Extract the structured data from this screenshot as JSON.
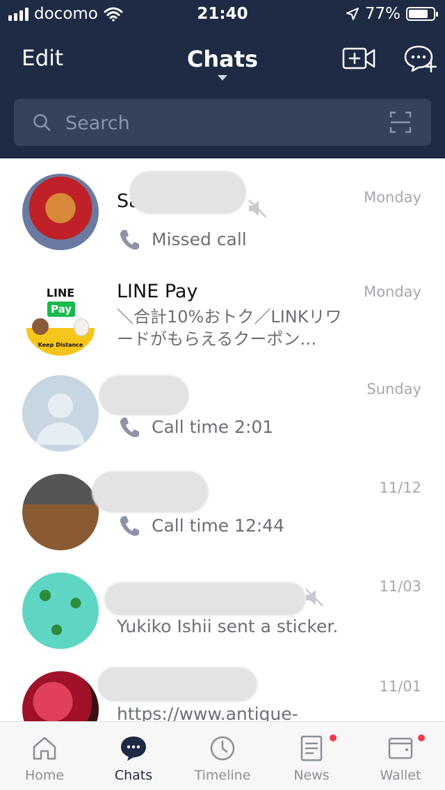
{
  "status": {
    "carrier": "docomo",
    "time": "21:40",
    "battery": "77%"
  },
  "header": {
    "edit_label": "Edit",
    "title": "Chats"
  },
  "search": {
    "placeholder": "Search"
  },
  "chats": [
    {
      "name": "Sa",
      "date": "Monday",
      "message": "Missed call",
      "muted": true,
      "call": true
    },
    {
      "name": "LINE Pay",
      "date": "Monday",
      "message": "＼合計10%おトク／LINKリワードがもらえるクーポン…",
      "muted": false,
      "call": false
    },
    {
      "name": "",
      "date": "Sunday",
      "message": "Call time 2:01",
      "muted": false,
      "call": true
    },
    {
      "name": "",
      "date": "11/12",
      "message": "Call time 12:44",
      "muted": false,
      "call": true
    },
    {
      "name": "",
      "date": "11/03",
      "message": "Yukiko Ishii sent a sticker.",
      "muted": true,
      "call": false
    },
    {
      "name": "",
      "date": "11/01",
      "message": "https://www.antique-",
      "muted": false,
      "call": false
    }
  ],
  "linepay_logo": {
    "line": "LINE",
    "pay": "Pay",
    "badge": "Keep Distance"
  },
  "tabs": [
    {
      "label": "Home",
      "icon": "home-icon"
    },
    {
      "label": "Chats",
      "icon": "chats-icon",
      "active": true
    },
    {
      "label": "Timeline",
      "icon": "clock-icon"
    },
    {
      "label": "News",
      "icon": "news-icon",
      "badge": true
    },
    {
      "label": "Wallet",
      "icon": "wallet-icon",
      "badge": true
    }
  ],
  "colors": {
    "header_bg": "#1f2a44",
    "search_bg": "#36415b",
    "badge": "#f23a4a",
    "active_tab": "#1f2a44"
  }
}
